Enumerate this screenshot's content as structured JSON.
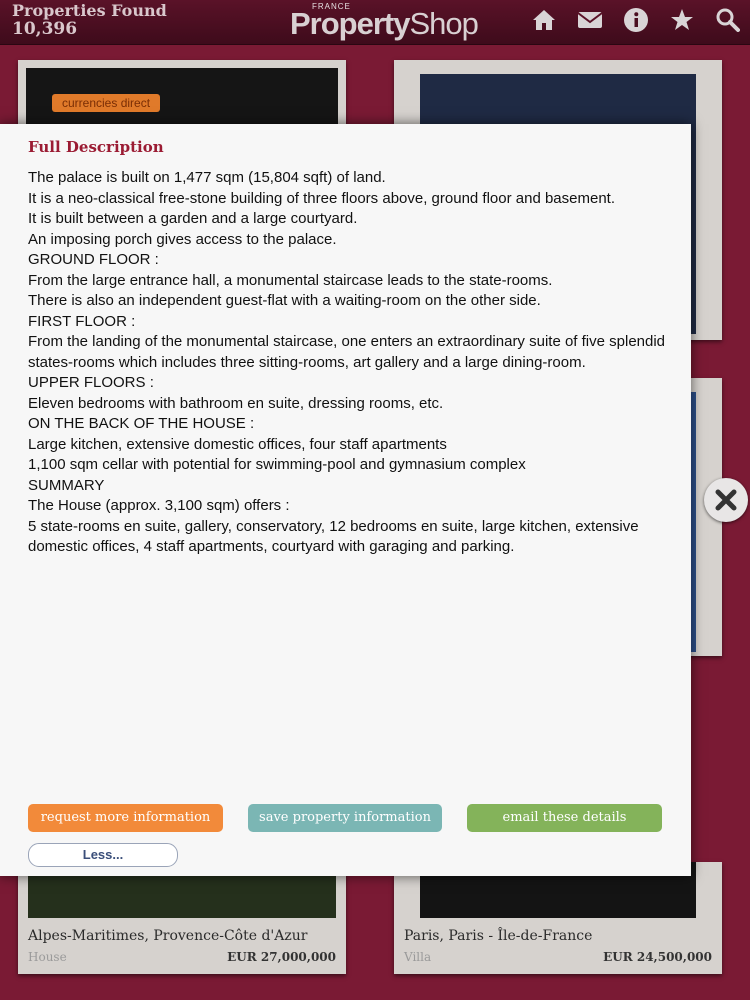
{
  "header": {
    "properties_found_label": "Properties Found",
    "properties_count": "10,396",
    "logo_country": "FRANCE",
    "logo_text_bold": "Property",
    "logo_text_thin": "Shop",
    "icons": [
      "home-icon",
      "mail-icon",
      "info-icon",
      "star-icon",
      "search-icon"
    ]
  },
  "background_cards": [
    {
      "badge": "currencies direct"
    },
    {
      "location": "Alpes-Maritimes, Provence-Côte d'Azur",
      "type": "House",
      "price": "EUR 27,000,000"
    },
    {
      "location": "Paris, Paris - Île-de-France",
      "type": "Villa",
      "price": "EUR 24,500,000"
    }
  ],
  "modal": {
    "title": "Full Description",
    "description_lines": [
      "The palace is built on 1,477 sqm (15,804 sqft) of land.",
      "It is a neo-classical free-stone building of three floors above, ground floor and basement.",
      "It is built between a garden and a large courtyard.",
      "An imposing porch gives access to the palace.",
      "GROUND FLOOR :",
      "From the large entrance hall, a monumental staircase leads to the state-rooms.",
      "There is also an independent guest-flat with a waiting-room on the other side.",
      "FIRST FLOOR :",
      "From the landing of the monumental staircase, one enters an extraordinary suite of five splendid states-rooms which includes three sitting-rooms, art gallery and a large dining-room.",
      "UPPER FLOORS :",
      "Eleven bedrooms with bathroom en suite, dressing rooms, etc.",
      "ON THE BACK OF THE HOUSE :",
      "Large kitchen, extensive domestic offices, four staff apartments",
      "1,100 sqm cellar with potential for swimming-pool and gymnasium complex",
      "SUMMARY",
      "The House (approx. 3,100 sqm) offers :",
      "5 state-rooms en suite, gallery, conservatory, 12 bedrooms en suite, large kitchen, extensive domestic offices, 4 staff apartments, courtyard with garaging and parking."
    ],
    "buttons": {
      "request": "request more information",
      "save": "save property information",
      "email": "email these details",
      "less": "Less..."
    }
  },
  "colors": {
    "background": "#7a1a34",
    "title_accent": "#9b1b33",
    "request_button": "#f28a3a",
    "save_button": "#7bb6b4",
    "email_button": "#84b35a"
  }
}
